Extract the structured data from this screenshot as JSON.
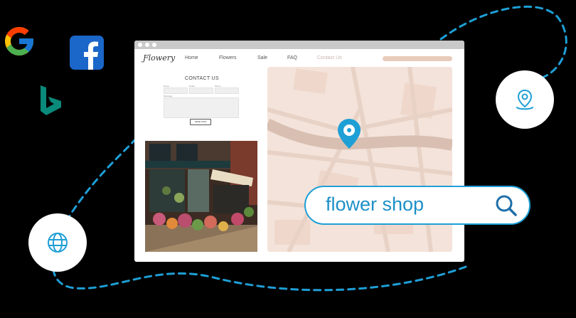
{
  "brand_logos": [
    "google-logo",
    "facebook-logo",
    "bing-logo"
  ],
  "browser": {
    "brand": "Ƒlowery",
    "nav": [
      "Home",
      "Flowers",
      "Sale",
      "FAQ",
      "Contact Us"
    ],
    "contact": {
      "title": "CONTACT US",
      "field_labels": [
        "Name",
        "Email",
        "Phone"
      ],
      "message_label": "Message",
      "send_label": "SEND NOW"
    }
  },
  "search": {
    "query": "flower shop",
    "icon": "search-icon"
  },
  "badges": [
    "location-pin-icon",
    "globe-icon"
  ],
  "colors": {
    "accent": "#1e9fd6",
    "map_bg": "#f4e3da",
    "map_road": "#d8bfb1",
    "background": "#000000"
  }
}
